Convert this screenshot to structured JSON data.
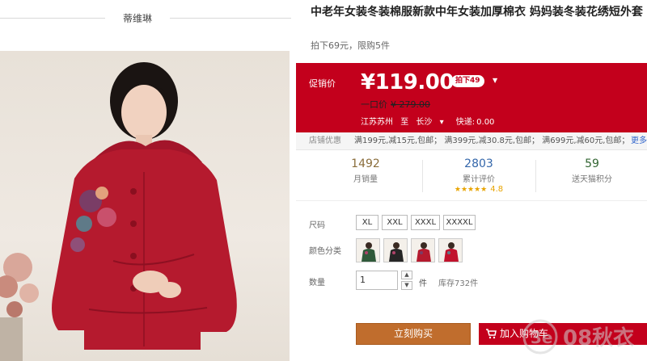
{
  "store": {
    "name": "蒂维琳"
  },
  "product": {
    "title": "中老年女装冬装棉服新款中年女装加厚棉衣 妈妈装冬装花绣短外套",
    "subtitle": "拍下69元，限购5件"
  },
  "price": {
    "label": "促销价",
    "current": "¥119.00",
    "badge": "拍下49",
    "original_label": "一口价",
    "original": "¥ 279.00"
  },
  "shipping": {
    "from": "江苏苏州",
    "to_label": "至",
    "to": "长沙",
    "express_label": "快递:",
    "express_fee": "0.00"
  },
  "promo": {
    "label": "店铺优惠",
    "items": "满199元,减15元,包邮； 满399元,减30.8元,包邮； 满699元,减60元,包邮；",
    "more": "更多"
  },
  "stats": [
    {
      "value": "1492",
      "label": "月销量"
    },
    {
      "value": "2803",
      "label": "累计评价",
      "rating": "4.8"
    },
    {
      "value": "59",
      "label": "送天猫积分"
    }
  ],
  "options": {
    "size_label": "尺码",
    "sizes": [
      "XL",
      "XXL",
      "XXXL",
      "XXXXL"
    ],
    "color_label": "颜色分类",
    "qty_label": "数量",
    "qty_value": "1",
    "qty_unit": "件",
    "stock": "库存732件"
  },
  "actions": {
    "buy": "立刻购买",
    "cart": "加入购物车"
  },
  "colors": {
    "brand_red": "#c3001c",
    "buy_orange": "#c06d2d",
    "star": "#e8a400"
  },
  "watermark": {
    "text": "08秋衣",
    "logo": "3e"
  }
}
